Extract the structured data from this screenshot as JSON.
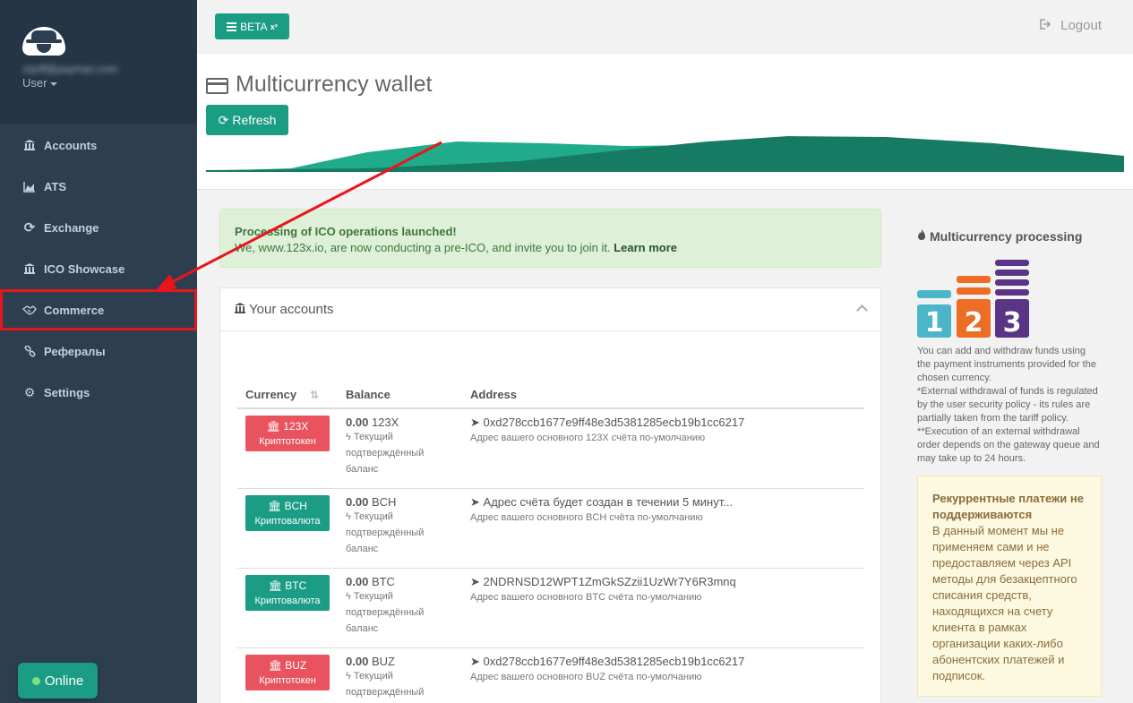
{
  "user": {
    "email": "zrjoff@payman.com",
    "role": "User"
  },
  "sidebar": {
    "items": [
      {
        "label": "Accounts",
        "icon": "bank-icon",
        "glyph": "🏛"
      },
      {
        "label": "ATS",
        "icon": "area-chart-icon",
        "glyph": "📈"
      },
      {
        "label": "Exchange",
        "icon": "refresh-icon",
        "glyph": "⟳"
      },
      {
        "label": "ICO Showcase",
        "icon": "bank-icon",
        "glyph": "🏛"
      },
      {
        "label": "Commerce",
        "icon": "handshake-icon",
        "glyph": "🤝"
      },
      {
        "label": "Рефералы",
        "icon": "link-icon",
        "glyph": "🔗"
      },
      {
        "label": "Settings",
        "icon": "gears-icon",
        "glyph": "⚙"
      }
    ],
    "online_label": "Online"
  },
  "topbar": {
    "beta_label": "BETA",
    "beta_sup": "x²",
    "logout_label": "Logout"
  },
  "page": {
    "title": "Multicurrency wallet",
    "refresh_label": "Refresh"
  },
  "alert": {
    "title": "Processing of ICO operations launched!",
    "text": "We, www.123x.io, are now conducting a pre-ICO, and invite you to join it.",
    "link": "Learn more"
  },
  "accounts": {
    "heading": "Your accounts",
    "columns": [
      "Currency",
      "Balance",
      "Address"
    ],
    "rows": [
      {
        "code": "123X",
        "type": "Криптотокен",
        "color": "#e8535d",
        "amount": "0.00",
        "unit": "123X",
        "note": "Текущий подтверждённый баланс",
        "address": "0xd278ccb1677e9ff48e3d5381285ecb19b1cc6217",
        "address_note": "Адрес вашего основного 123X счёта по-умолчанию"
      },
      {
        "code": "BCH",
        "type": "Криптовалюта",
        "color": "#1b9c85",
        "amount": "0.00",
        "unit": "BCH",
        "note": "Текущий подтверждённый баланс",
        "address": "Адрес счёта будет создан в течении 5 минут...",
        "address_note": "Адрес вашего основного BCH счёта по-умолчанию"
      },
      {
        "code": "BTC",
        "type": "Криптовалюта",
        "color": "#1b9c85",
        "amount": "0.00",
        "unit": "BTC",
        "note": "Текущий подтверждённый баланс",
        "address": "2NDRNSD12WPT1ZmGkSZzii1UzWr7Y6R3mnq",
        "address_note": "Адрес вашего основного BTC счёта по-умолчанию"
      },
      {
        "code": "BUZ",
        "type": "Криптотокен",
        "color": "#e8535d",
        "amount": "0.00",
        "unit": "BUZ",
        "note": "Текущий подтверждённый",
        "address": "0xd278ccb1677e9ff48e3d5381285ecb19b1cc6217",
        "address_note": "Адрес вашего основного BUZ счёта по-умолчанию"
      }
    ]
  },
  "processing": {
    "title": "Multicurrency processing",
    "logo_digits": [
      "1",
      "2",
      "3"
    ],
    "description": "You can add and withdraw funds using the payment instruments provided for the chosen currency.\n*External withdrawal of funds is regulated by the user security policy - its rules are partially taken from the tariff policy.\n**Execution of an external withdrawal order depends on the gateway queue and may take up to 24 hours."
  },
  "warning": {
    "title": "Рекуррентные платежи не поддерживаются",
    "text": "В данный момент мы не применяем сами и не предоставляем через API методы для безакцептного списания средств, находящихся на счету клиента в рамках организации каких-либо абонентских платежей и подписок."
  },
  "colors": {
    "accent": "#1b9c85",
    "sidebar": "#2c3e50",
    "token": "#e8535d",
    "annotation": "#e8151b"
  }
}
